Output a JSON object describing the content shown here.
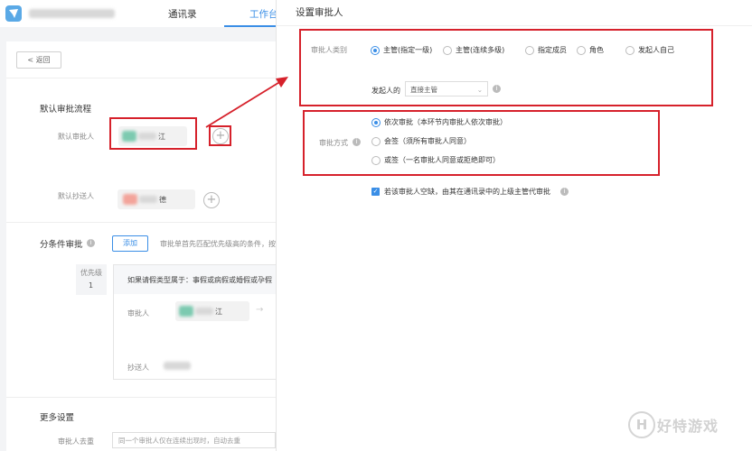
{
  "nav": {
    "app_name_blur": "",
    "tabs": [
      {
        "label": "通讯录"
      },
      {
        "label": "工作台"
      }
    ]
  },
  "left": {
    "back_label": "< 返回",
    "default_flow_title": "默认审批流程",
    "default_approver_label": "默认审批人",
    "default_approver_name_suffix": "江",
    "default_cc_label": "默认抄送人",
    "default_cc_name_suffix": "德",
    "conditional_title": "分条件审批",
    "add_button": "添加",
    "conditional_hint": "审批单首先匹配优先级高的条件，按",
    "priority_label": "优先级",
    "priority_value": "1",
    "condition_text": "如果请假类型属于：事假或病假或婚假或孕假",
    "cond_approver_label": "审批人",
    "cond_approver_suffix": "江",
    "cond_cc_label": "抄送人",
    "more_settings_title": "更多设置",
    "dedupe_label": "审批人去重",
    "dedupe_value": "同一个审批人仅在连续出现时，自动去重"
  },
  "right": {
    "title": "设置审批人",
    "approver_type_label": "审批人类别",
    "approver_types": [
      {
        "label": "主管(指定一级)",
        "selected": true
      },
      {
        "label": "主管(连续多级)",
        "selected": false
      },
      {
        "label": "指定成员",
        "selected": false
      },
      {
        "label": "角色",
        "selected": false
      },
      {
        "label": "发起人自己",
        "selected": false
      }
    ],
    "initiator_label": "发起人的",
    "initiator_select": "直接主管",
    "method_label": "审批方式",
    "methods": [
      {
        "label": "依次审批（本环节内审批人依次审批）",
        "selected": true
      },
      {
        "label": "会签（须所有审批人同意）",
        "selected": false
      },
      {
        "label": "或签（一名审批人同意或拒绝即可）",
        "selected": false
      }
    ],
    "fallback_checkbox": "若该审批人空缺，由其在通讯录中的上级主管代审批",
    "fallback_checked": true
  },
  "watermark": {
    "text": "好特游戏",
    "letter": "H"
  },
  "colors": {
    "accent": "#3a8ee6",
    "highlight": "#d6212b"
  }
}
